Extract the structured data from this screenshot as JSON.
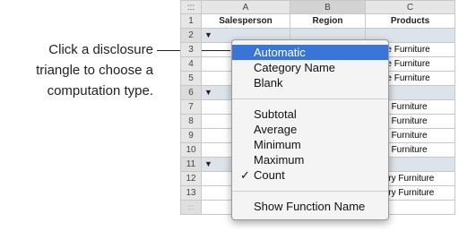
{
  "callout": {
    "line1": "Click a disclosure",
    "line2": "triangle to choose a",
    "line3": "computation type."
  },
  "sheet": {
    "corner": ":::",
    "columns": [
      "A",
      "B",
      "C"
    ],
    "rows": [
      {
        "n": "1",
        "a": "Salesperson",
        "b": "Region",
        "c": "Products",
        "type": "header"
      },
      {
        "n": "2",
        "a": "",
        "b": "",
        "c": "",
        "type": "cat"
      },
      {
        "n": "3",
        "a": "",
        "b": "",
        "c": "Office Furniture",
        "type": "data"
      },
      {
        "n": "4",
        "a": "",
        "b": "",
        "c": "Office Furniture",
        "type": "data"
      },
      {
        "n": "5",
        "a": "",
        "b": "",
        "c": "Office Furniture",
        "type": "data"
      },
      {
        "n": "6",
        "a": "",
        "b": "",
        "c": "",
        "type": "cat"
      },
      {
        "n": "7",
        "a": "",
        "b": "",
        "c": "Patio Furniture",
        "type": "data"
      },
      {
        "n": "8",
        "a": "",
        "b": "",
        "c": "Patio Furniture",
        "type": "data"
      },
      {
        "n": "9",
        "a": "",
        "b": "",
        "c": "Patio Furniture",
        "type": "data"
      },
      {
        "n": "10",
        "a": "",
        "b": "",
        "c": "Patio Furniture",
        "type": "data"
      },
      {
        "n": "11",
        "a": "",
        "b": "",
        "c": "",
        "type": "cat"
      },
      {
        "n": "12",
        "a": "",
        "b": "",
        "c": "Library Furniture",
        "type": "data"
      },
      {
        "n": "13",
        "a": "",
        "b": "",
        "c": "Library Furniture",
        "type": "data"
      },
      {
        "n": ":::",
        "a": "",
        "b": "",
        "c": "",
        "type": "footer"
      }
    ]
  },
  "menu": {
    "items": [
      {
        "label": "Automatic",
        "highlighted": true
      },
      {
        "label": "Category Name"
      },
      {
        "label": "Blank"
      },
      {
        "label": "Subtotal"
      },
      {
        "label": "Average"
      },
      {
        "label": "Minimum"
      },
      {
        "label": "Maximum"
      },
      {
        "label": "Count",
        "checked": true,
        "check": "✓"
      },
      {
        "label": "Show Function Name"
      }
    ]
  }
}
